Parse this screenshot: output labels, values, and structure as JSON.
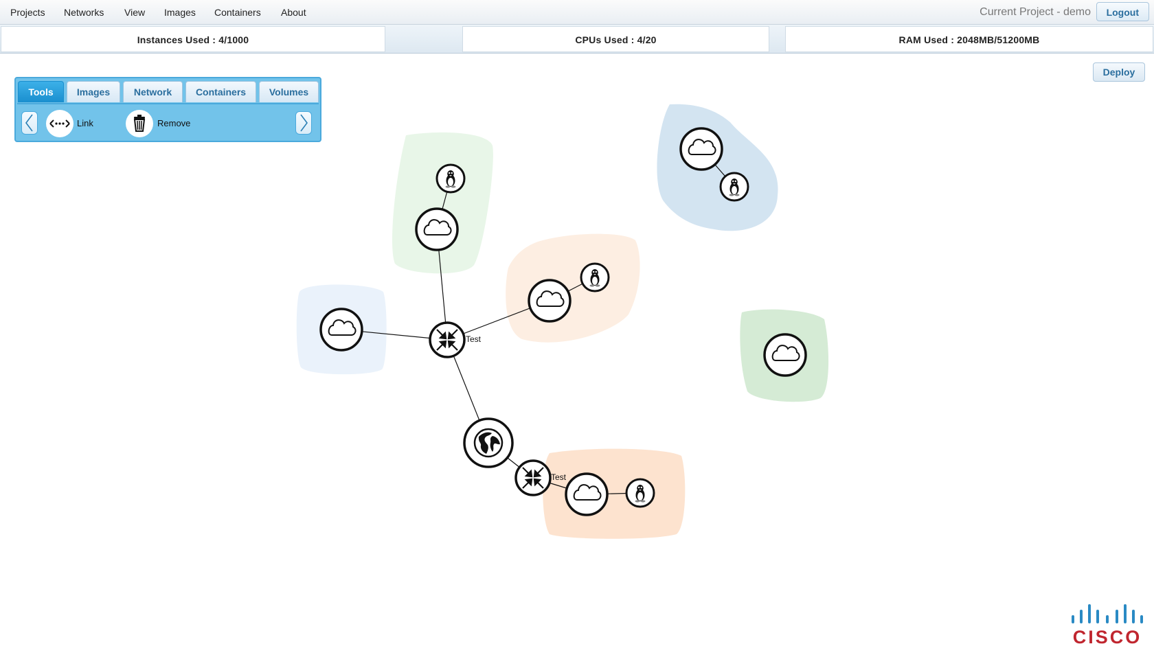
{
  "menu": {
    "items": [
      "Projects",
      "Networks",
      "View",
      "Images",
      "Containers",
      "About"
    ],
    "current_project": "Current Project - demo",
    "logout_label": "Logout"
  },
  "usage": {
    "instances": "Instances Used : 4/1000",
    "cpus": "CPUs Used : 4/20",
    "ram": "RAM Used : 2048MB/51200MB"
  },
  "deploy_label": "Deploy",
  "toolbox": {
    "tabs": [
      "Tools",
      "Images",
      "Network",
      "Containers",
      "Volumes"
    ],
    "active_tab": "Tools",
    "tools": [
      {
        "label": "Link",
        "icon": "link-icon"
      },
      {
        "label": "Remove",
        "icon": "trash-icon"
      }
    ]
  },
  "topology": {
    "router_labels": [
      "Test",
      "Test"
    ],
    "node_types": [
      "cloud-network",
      "linux-instance",
      "router",
      "internet-gateway"
    ],
    "region_colors": [
      "#e8f6e8",
      "#d3e4f1",
      "#fdeee2",
      "#eaf2fb",
      "#d5ebd5",
      "#fde3cf"
    ]
  },
  "logo": {
    "text": "CISCO",
    "color": "#c0262f"
  }
}
